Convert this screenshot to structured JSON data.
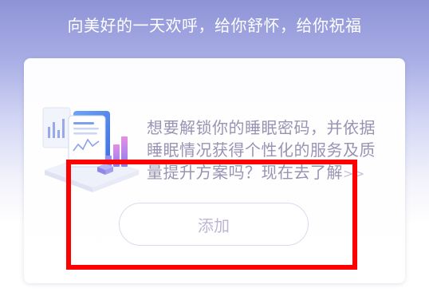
{
  "header": {
    "greeting": "向美好的一天欢呼，给你舒怀，给你祝福"
  },
  "card": {
    "illustration_icon": "sleep-report-chart-icon",
    "promo_text": "想要解锁你的睡眠密码，并依据睡眠情况获得个性化的服务及质量提升方案吗？现在去了解",
    "learn_more_arrow": ">>",
    "add_button_label": "添加"
  },
  "colors": {
    "highlight": "#ff0000",
    "accent_purple": "#8e93d7",
    "text_muted": "#9a93b3"
  }
}
